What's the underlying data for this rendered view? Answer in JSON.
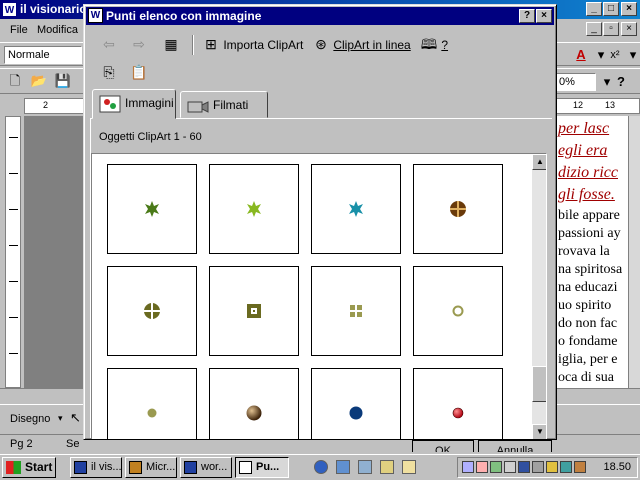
{
  "word": {
    "title": "il visionario",
    "menu": [
      "File",
      "Modifica"
    ],
    "style_value": "Normale",
    "zoom_value": "0%",
    "ruler_marks": [
      "2",
      "12",
      "13"
    ],
    "page_text_red": [
      "per lasc",
      "egli era",
      "dizio ricc",
      "gli fosse."
    ],
    "page_text": [
      "bile appare",
      "passioni ay",
      "rovava la",
      "na spiritosa",
      "na educazi",
      "uo spirito",
      "do non fac",
      "o fondame",
      "iglia, per e",
      "oca di sua"
    ],
    "draw_label": "Disegno",
    "status_page": "Pg 2",
    "status_section": "Se"
  },
  "dialog": {
    "title": "Punti elenco con immagine",
    "toolbar": {
      "import_label": "Importa ClipArt",
      "online_label": "ClipArt in linea",
      "help_label": "?"
    },
    "tabs": [
      {
        "label": "Immagini"
      },
      {
        "label": "Filmati"
      }
    ],
    "count_label": "Oggetti ClipArt 1 - 60",
    "ok_label": "OK",
    "cancel_label": "Annulla",
    "colors": {
      "green_star": "#4a7a18",
      "lime_star": "#88b820",
      "teal_star": "#1890a8",
      "brown_disc": "#6a3a0a",
      "olive": "#6a6a20",
      "olive_light": "#9a9a50",
      "blue": "#0a3a7a",
      "red": "#b00010"
    }
  },
  "taskbar": {
    "start_label": "Start",
    "buttons": [
      {
        "label": "il vis..."
      },
      {
        "label": "Micr..."
      },
      {
        "label": "wor..."
      },
      {
        "label": "Pu..."
      }
    ],
    "clock": "18.50"
  }
}
